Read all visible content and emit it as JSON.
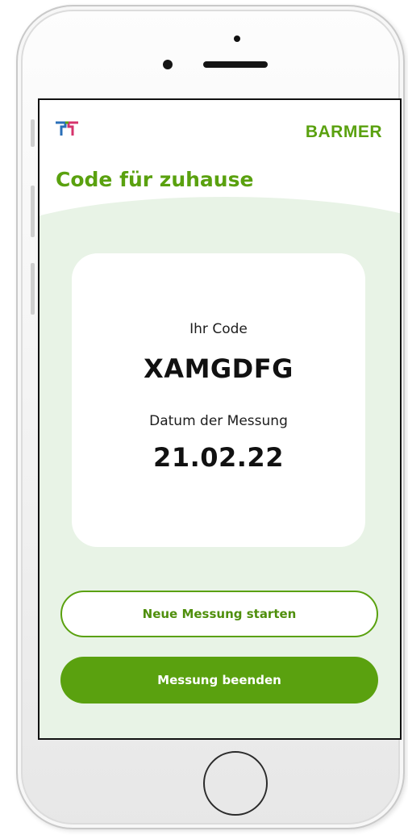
{
  "header": {
    "brand": "BARMER",
    "title": "Code für zuhause",
    "logo_icon": "tk-logo-icon"
  },
  "card": {
    "code_label": "Ihr Code",
    "code_value": "XAMGDFG",
    "date_label": "Datum der Messung",
    "date_value": "21.02.22"
  },
  "actions": {
    "new_measurement": "Neue Messung starten",
    "end_measurement": "Messung beenden"
  },
  "colors": {
    "accent": "#5aa10f",
    "background_tint": "#e8f3e6"
  }
}
